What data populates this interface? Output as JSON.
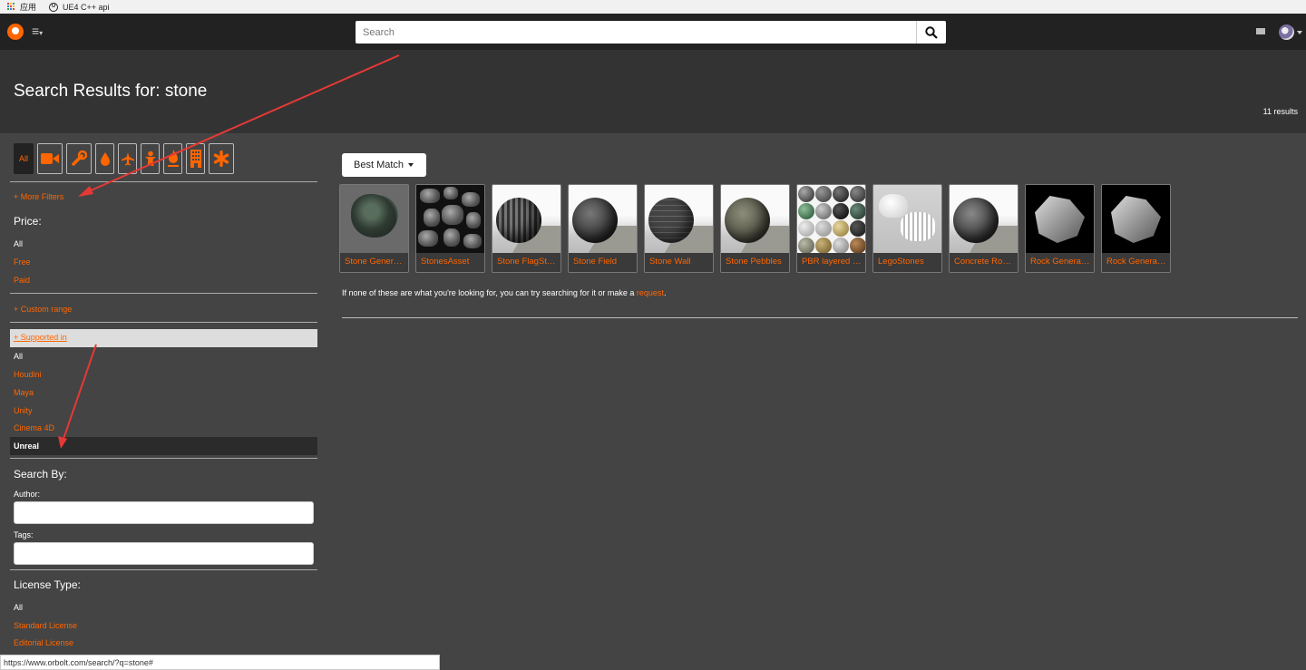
{
  "bookmarks": [
    {
      "label": "应用",
      "icon": "apps-grid-icon"
    },
    {
      "label": "UE4 C++ api",
      "icon": "unreal-engine-icon"
    }
  ],
  "nav": {
    "logo": "orbolt-logo-icon",
    "search_placeholder": "Search",
    "icons": [
      "menu-icon",
      "search-icon",
      "mail-icon",
      "avatar"
    ]
  },
  "header": {
    "title": "Search Results for: stone",
    "results_count": "11 results"
  },
  "sidebar": {
    "categories": [
      {
        "label": "All",
        "icon": null
      },
      {
        "label": "",
        "icon": "video-camera-icon"
      },
      {
        "label": "",
        "icon": "wrench-icon"
      },
      {
        "label": "",
        "icon": "drop-icon"
      },
      {
        "label": "",
        "icon": "plane-icon"
      },
      {
        "label": "",
        "icon": "character-icon"
      },
      {
        "label": "",
        "icon": "fire-icon"
      },
      {
        "label": "",
        "icon": "building-icon"
      },
      {
        "label": "",
        "icon": "asterisk-icon"
      }
    ],
    "more_filters": "+ More Filters",
    "price": {
      "heading": "Price:",
      "all": "All",
      "free": "Free",
      "paid": "Paid",
      "custom_range": "+ Custom range"
    },
    "supported": {
      "heading": "+ Supported in",
      "all": "All",
      "options": [
        "Houdini",
        "Maya",
        "Unity",
        "Cinema 4D"
      ],
      "selected": "Unreal"
    },
    "search_by": {
      "heading": "Search By:",
      "author_label": "Author:",
      "tags_label": "Tags:"
    },
    "license": {
      "heading": "License Type:",
      "all": "All",
      "options": [
        "Standard License",
        "Editorial License"
      ]
    }
  },
  "main": {
    "sort_label": "Best Match",
    "results": [
      {
        "label": "Stone Generator",
        "thumb": "rock"
      },
      {
        "label": "StonesAsset",
        "thumb": "stones"
      },
      {
        "label": "Stone FlagStone",
        "thumb": "sphere-1"
      },
      {
        "label": "Stone Field",
        "thumb": "sphere-2"
      },
      {
        "label": "Stone Wall",
        "thumb": "sphere-3"
      },
      {
        "label": "Stone Pebbles",
        "thumb": "sphere-4"
      },
      {
        "label": "PBR layered Materials",
        "thumb": "pbr"
      },
      {
        "label": "LegoStones",
        "thumb": "lego"
      },
      {
        "label": "Concrete Rocks",
        "thumb": "sphere-5"
      },
      {
        "label": "Rock Generator",
        "thumb": "rock3d"
      },
      {
        "label": "Rock Generator",
        "thumb": "rock3d"
      }
    ],
    "notice_before": "If none of these are what you're looking for, you can try searching for it or make a ",
    "notice_link": "request",
    "notice_after": "."
  },
  "status_url": "https://www.orbolt.com/search/?q=stone#",
  "colors": {
    "accent": "#ff6600",
    "annotation": "#e53935"
  }
}
